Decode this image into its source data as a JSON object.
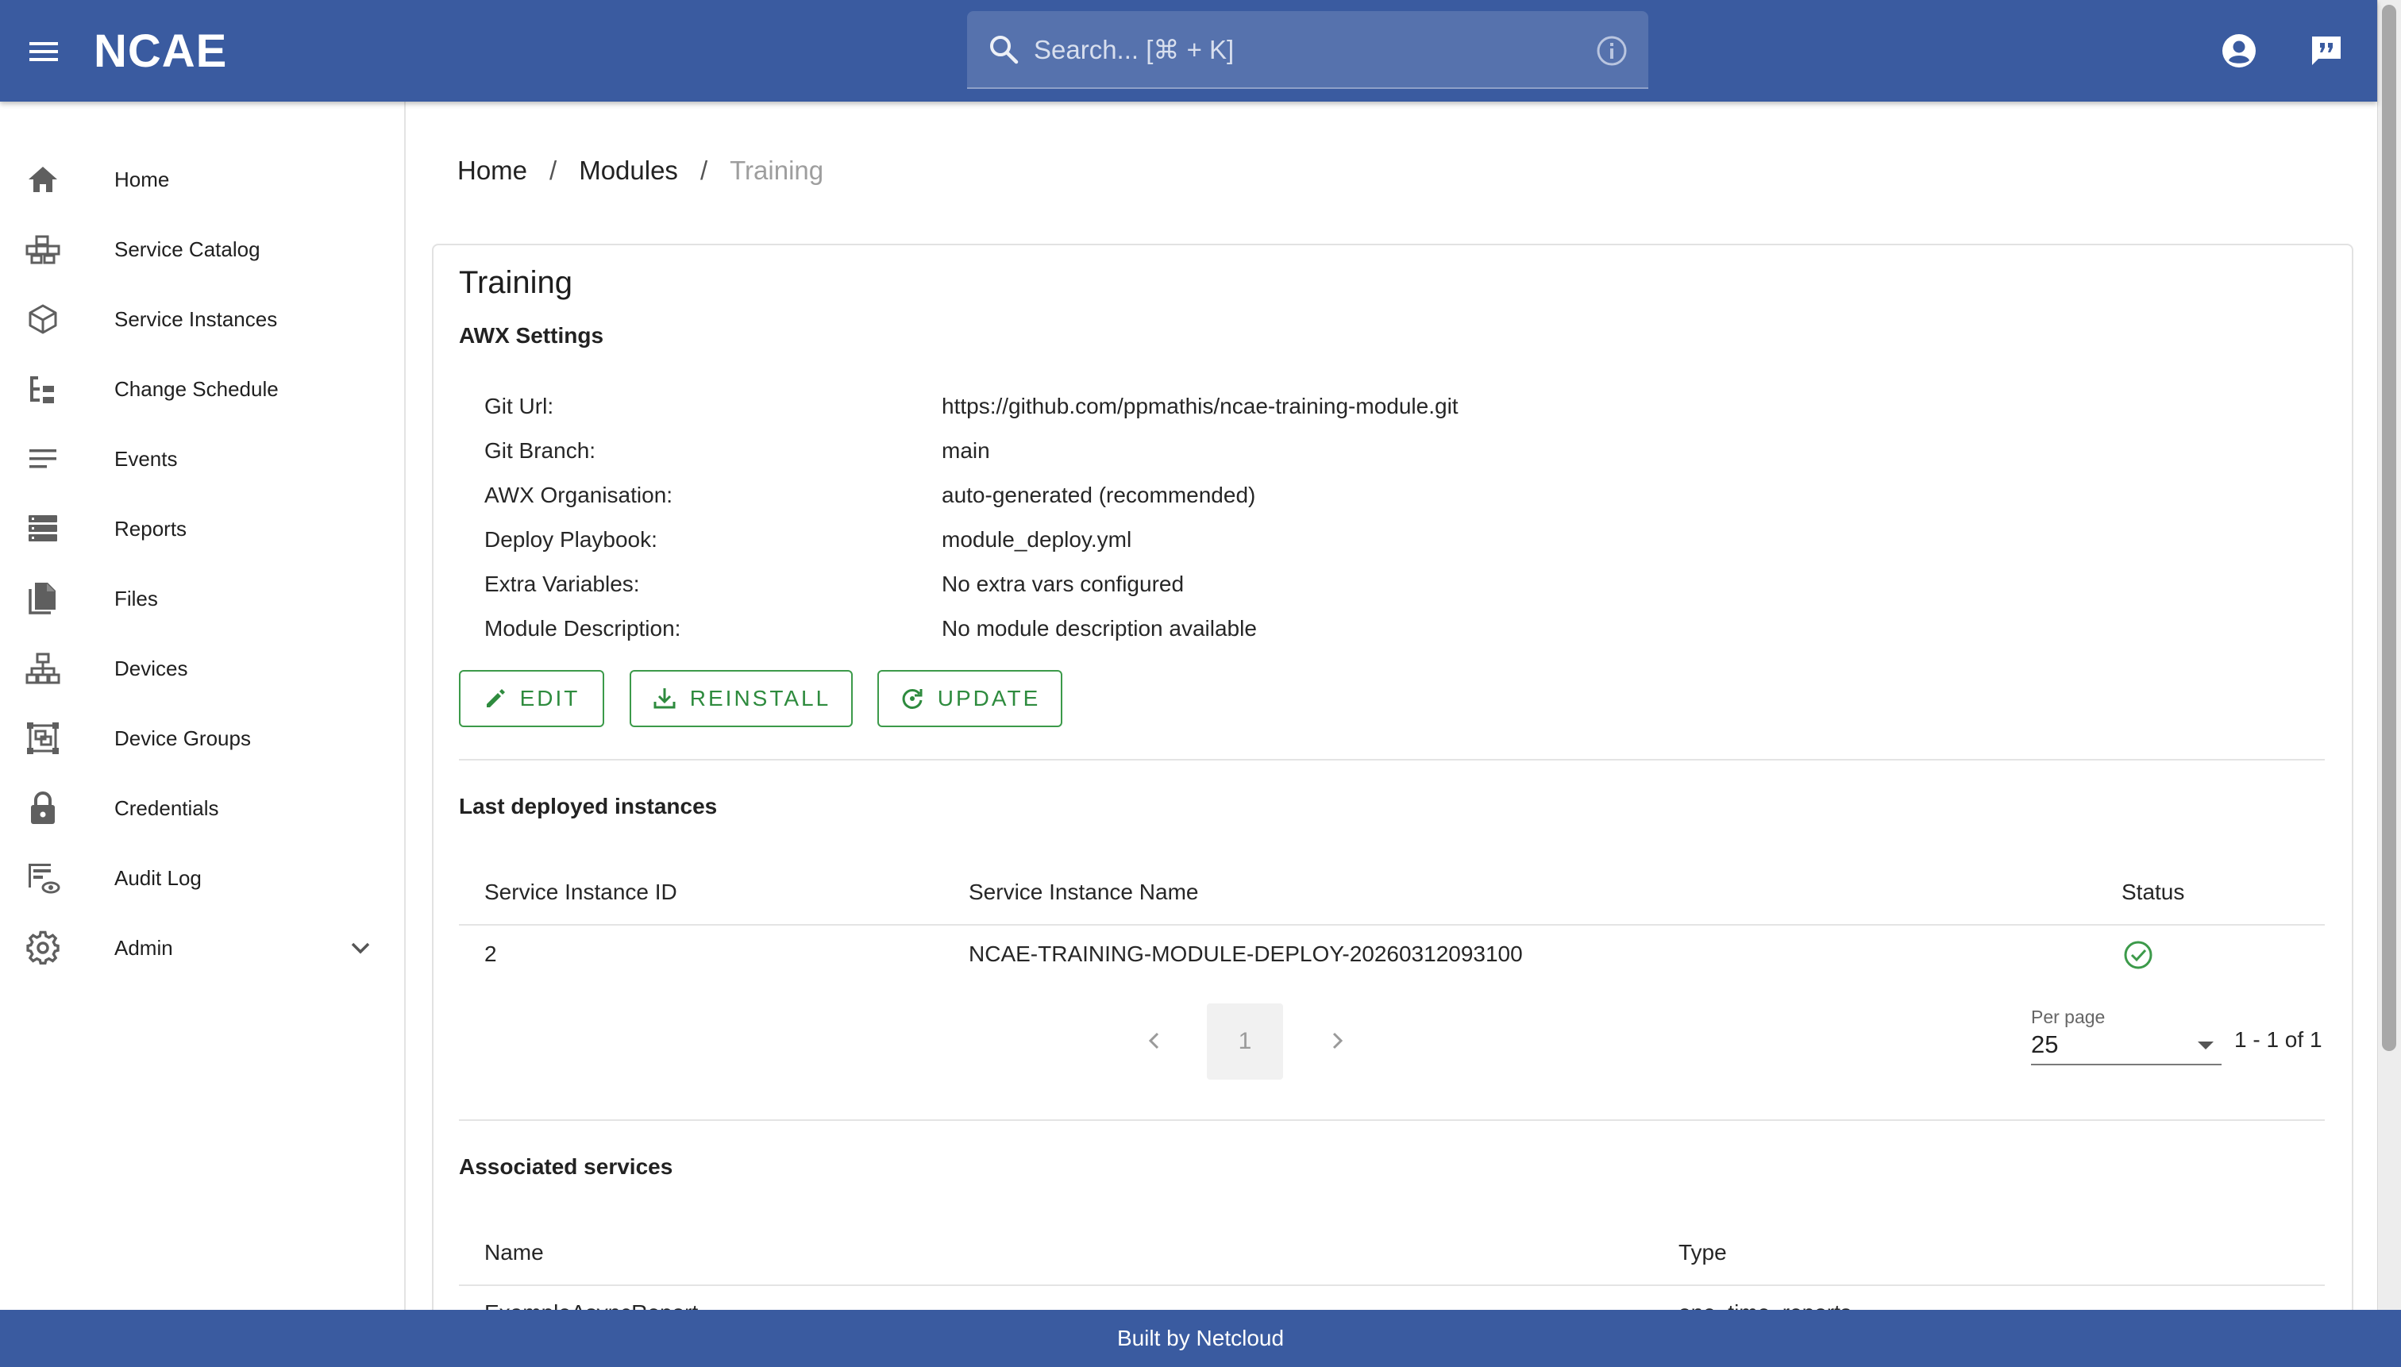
{
  "appbar": {
    "logo_text": "NCAE",
    "search_placeholder": "Search... [⌘ + K]",
    "brand_color": "#3a5ba0"
  },
  "sidebar": {
    "items": [
      {
        "label": "Home",
        "icon": "home-icon"
      },
      {
        "label": "Service Catalog",
        "icon": "catalog-icon"
      },
      {
        "label": "Service Instances",
        "icon": "cube-icon"
      },
      {
        "label": "Change Schedule",
        "icon": "schedule-icon"
      },
      {
        "label": "Events",
        "icon": "lines-icon"
      },
      {
        "label": "Reports",
        "icon": "reports-icon"
      },
      {
        "label": "Files",
        "icon": "files-icon"
      },
      {
        "label": "Devices",
        "icon": "devices-icon"
      },
      {
        "label": "Device Groups",
        "icon": "device-groups-icon"
      },
      {
        "label": "Credentials",
        "icon": "lock-icon"
      },
      {
        "label": "Audit Log",
        "icon": "audit-icon"
      },
      {
        "label": "Admin",
        "icon": "gear-icon"
      }
    ]
  },
  "breadcrumb": {
    "items": [
      "Home",
      "Modules",
      "Training"
    ],
    "separator": "/"
  },
  "module": {
    "title": "Training",
    "settings_title": "AWX Settings",
    "settings": [
      {
        "label": "Git Url:",
        "value": "https://github.com/ppmathis/ncae-training-module.git"
      },
      {
        "label": "Git Branch:",
        "value": "main"
      },
      {
        "label": "AWX Organisation:",
        "value": "auto-generated (recommended)"
      },
      {
        "label": "Deploy Playbook:",
        "value": "module_deploy.yml"
      },
      {
        "label": "Extra Variables:",
        "value": "No extra vars configured"
      },
      {
        "label": "Module Description:",
        "value": "No module description available"
      }
    ],
    "actions": {
      "edit": "EDIT",
      "reinstall": "REINSTALL",
      "update": "UPDATE",
      "accent_color": "#3c9a4a"
    }
  },
  "instances": {
    "title": "Last deployed instances",
    "columns": [
      "Service Instance ID",
      "Service Instance Name",
      "Status"
    ],
    "rows": [
      {
        "id": "2",
        "name": "NCAE-TRAINING-MODULE-DEPLOY-20260312093100",
        "status": "success"
      }
    ],
    "pagination": {
      "current_page": "1",
      "per_page_label": "Per page",
      "per_page": "25",
      "range": "1 - 1 of 1"
    }
  },
  "services": {
    "title": "Associated services",
    "columns": [
      "Name",
      "Type"
    ],
    "rows": [
      {
        "name": "ExampleAsyncReport",
        "type": "one_time_reports"
      }
    ]
  },
  "footer": {
    "text": "Built by Netcloud"
  }
}
